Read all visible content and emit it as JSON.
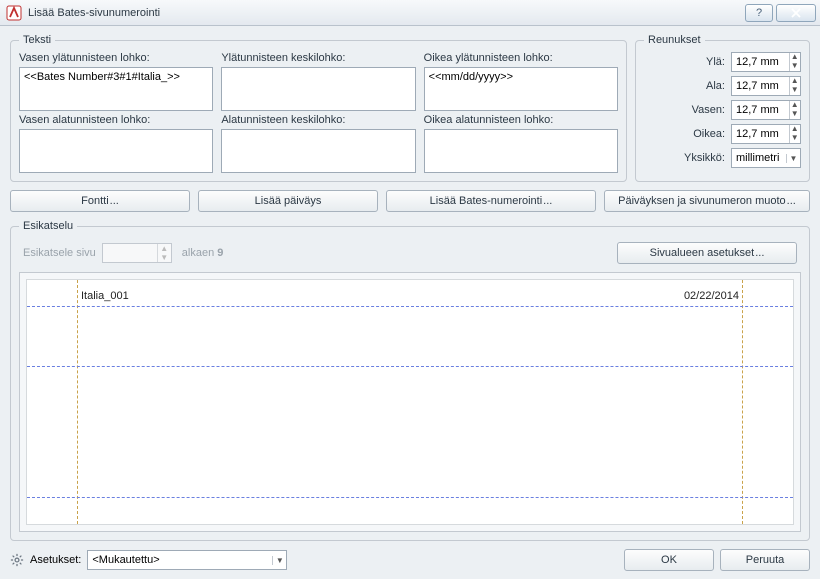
{
  "window": {
    "title": "Lisää Bates-sivunumerointi"
  },
  "teksti": {
    "legend": "Teksti",
    "labels": {
      "topLeft": "Vasen ylätunnisteen lohko:",
      "topCenter": "Ylätunnisteen keskilohko:",
      "topRight": "Oikea ylätunnisteen lohko:",
      "botLeft": "Vasen alatunnisteen lohko:",
      "botCenter": "Alatunnisteen keskilohko:",
      "botRight": "Oikea alatunnisteen lohko:"
    },
    "values": {
      "topLeft": "<<Bates Number#3#1#Italia_>>",
      "topCenter": "",
      "topRight": "<<mm/dd/yyyy>>",
      "botLeft": "",
      "botCenter": "",
      "botRight": ""
    }
  },
  "reunukset": {
    "legend": "Reunukset",
    "labels": {
      "top": "Ylä:",
      "bottom": "Ala:",
      "left": "Vasen:",
      "right": "Oikea:",
      "unit": "Yksikkö:"
    },
    "values": {
      "top": "12,7 mm",
      "bottom": "12,7 mm",
      "left": "12,7 mm",
      "right": "12,7 mm",
      "unit": "millimetri"
    }
  },
  "buttons": {
    "font": "Fontti",
    "insertDate": "Lisää päiväys",
    "insertBates": "Lisää Bates-numerointi",
    "dateFormat": "Päiväyksen ja sivunumeron muoto"
  },
  "esikatselu": {
    "legend": "Esikatselu",
    "previewPageLabel": "Esikatsele sivu",
    "alkaenLabel": "alkaen",
    "alkaenValue": "9",
    "pageRangeBtn": "Sivualueen asetukset",
    "rendered": {
      "topLeft": "Italia_001",
      "topRight": "02/22/2014"
    }
  },
  "footer": {
    "settingsLabel": "Asetukset:",
    "settingsValue": "<Mukautettu>",
    "ok": "OK",
    "cancel": "Peruuta"
  }
}
